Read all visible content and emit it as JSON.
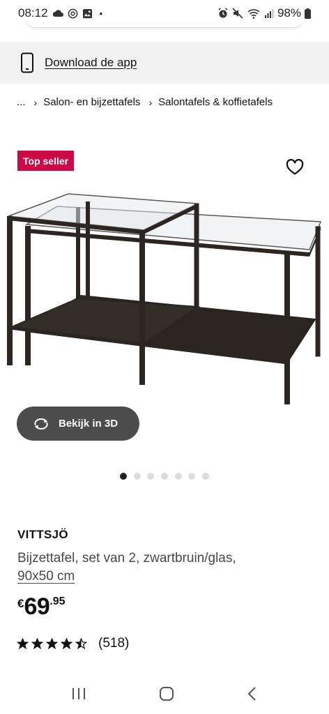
{
  "status_bar": {
    "time": "08:12",
    "dot": "•",
    "battery": "98%",
    "icons_left": [
      "cloud-icon",
      "sync-icon",
      "gallery-icon"
    ],
    "icons_right": [
      "alarm-icon",
      "mute-icon",
      "wifi-icon",
      "signal-icon",
      "battery-icon"
    ]
  },
  "app_banner": {
    "icon": "phone-icon",
    "link": "Download de app"
  },
  "breadcrumb": {
    "ellipsis": "...",
    "items": [
      "Salon- en bijzettafels",
      "Salontafels & koffietafels"
    ],
    "separator": "›"
  },
  "badge": {
    "label": "Top seller",
    "color": "#cc0a48"
  },
  "gallery": {
    "button_3d": "Bekijk in 3D",
    "dot_count": 7,
    "active_dot": 0
  },
  "product": {
    "name": "VITTSJÖ",
    "description": "Bijzettafel, set van 2, zwartbruin/glas,",
    "size": "90x50 cm",
    "price": {
      "currency": "€",
      "integer": "69",
      "decimal": ".95"
    },
    "rating": {
      "value": 4.5,
      "max": 5,
      "count": "(518)"
    }
  },
  "nav_bar": {
    "items": [
      "recent-apps-icon",
      "home-icon",
      "back-icon"
    ]
  }
}
